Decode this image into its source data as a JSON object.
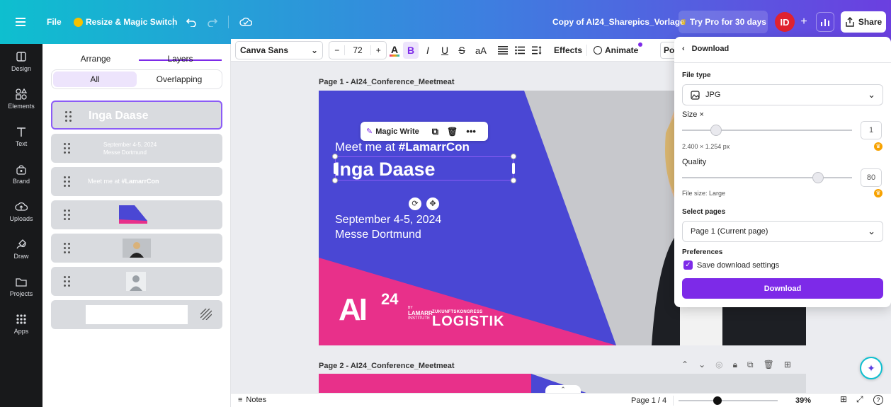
{
  "topbar": {
    "file_label": "File",
    "resize_label": "Resize & Magic Switch",
    "doc_title": "Copy of AI24_Sharepics_Vorlage",
    "try_pro_label": "Try Pro for 30 days",
    "avatar_initials": "ID",
    "share_label": "Share"
  },
  "rail": {
    "items": [
      {
        "label": "Design",
        "icon": "design-icon"
      },
      {
        "label": "Elements",
        "icon": "elements-icon"
      },
      {
        "label": "Text",
        "icon": "text-icon"
      },
      {
        "label": "Brand",
        "icon": "brand-icon"
      },
      {
        "label": "Uploads",
        "icon": "uploads-icon"
      },
      {
        "label": "Draw",
        "icon": "draw-icon"
      },
      {
        "label": "Projects",
        "icon": "projects-icon"
      },
      {
        "label": "Apps",
        "icon": "apps-icon"
      }
    ]
  },
  "layers_panel": {
    "tabs": [
      "Arrange",
      "Layers"
    ],
    "active_tab": "Layers",
    "filters": [
      "All",
      "Overlapping"
    ],
    "items": [
      {
        "text": "Inga Daase"
      },
      {
        "text1": "September 4-5, 2024",
        "text2": "Messe Dortmund"
      },
      {
        "text": "Meet me at ",
        "bold": "#LamarrCon"
      }
    ]
  },
  "toolbar": {
    "font": "Canva Sans",
    "size": "72",
    "minus": "−",
    "plus": "+",
    "bold": "B",
    "italic": "I",
    "underline": "U",
    "strike": "S",
    "case": "aA",
    "effects": "Effects",
    "animate": "Animate",
    "position": "Po"
  },
  "canvas": {
    "page1_label": "Page 1 - AI24_Conference_Meetmeat",
    "page2_label": "Page 2 - AI24_Conference_Meetmeat",
    "magic_write": "Magic Write",
    "meet_prefix": "Meet me at ",
    "meet_hashtag": "#LamarrCon",
    "name": "Inga Daase",
    "date": "September 4-5, 2024",
    "venue": "Messe Dortmund",
    "logo_main": "AI",
    "logo_num": "24",
    "logo_by": "BY",
    "logo_lamarr": "LAMARR",
    "logo_institute": "INSTITUTE",
    "kongress": "ZUKUNFTSKONGRESS",
    "logistik": "LOGISTIK",
    "colors": {
      "purple": "#4a47d4",
      "pink": "#e8308a"
    }
  },
  "download": {
    "title": "Download",
    "file_type_label": "File type",
    "file_type_value": "JPG",
    "size_label": "Size ×",
    "size_value": "1",
    "size_fraction": 0.2,
    "dimensions": "2.400 × 1.254 px",
    "quality_label": "Quality",
    "quality_value": "80",
    "quality_fraction": 0.8,
    "file_size": "File size: Large",
    "select_pages_label": "Select pages",
    "select_pages_value": "Page 1 (Current page)",
    "preferences_label": "Preferences",
    "save_settings_label": "Save download settings",
    "download_button": "Download",
    "accent": "#7d2ae8"
  },
  "bottombar": {
    "notes_label": "Notes",
    "page_indicator": "Page 1 / 4",
    "zoom": "39%",
    "zoom_fraction": 0.39
  }
}
